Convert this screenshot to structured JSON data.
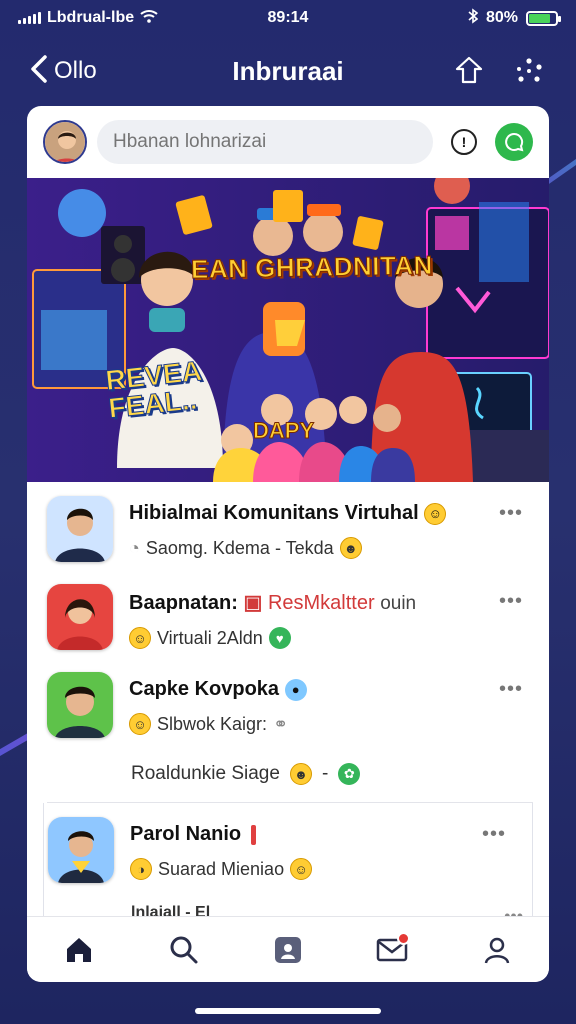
{
  "status_bar": {
    "carrier": "Lbdrual-lbe",
    "time": "89:14",
    "battery": "80%",
    "battery_level": 0.8
  },
  "nav": {
    "back_label": "Ollo",
    "title": "Inbruraai",
    "icons": [
      "share-icon",
      "sparkle-icon"
    ]
  },
  "compose": {
    "placeholder": "Hbanan lohnarizai",
    "info_glyph": "!",
    "accent": "#2eb84c"
  },
  "banner": {
    "title": "EAN GHRADNITAN",
    "sub_line1": "REVEA",
    "sub_line2": "FEAL..",
    "tag": "DAPY"
  },
  "feed": [
    {
      "name": "Hibialmai Komunitans Virtuhal",
      "sub": "Saomg. Kdema - Tekda",
      "more": "•••"
    },
    {
      "name": "Baapnatan:",
      "name_red": "ResMkaltter",
      "name_tail": "ouin",
      "sub": "Virtuali 2Aldn",
      "more": "•••"
    },
    {
      "name": "Capke Kovpoka",
      "sub": "Slbwok Kaigr:",
      "extra": "Roaldunkie Siage",
      "more": "•••"
    },
    {
      "name": "Parol Nanio",
      "sub": "Suarad Mieniao",
      "more": "•••"
    }
  ],
  "peek": {
    "name": "lnlaiall - El",
    "more": "•••"
  },
  "tabs": [
    "home-icon",
    "search-icon",
    "profile-card-icon",
    "mail-icon",
    "user-icon"
  ]
}
